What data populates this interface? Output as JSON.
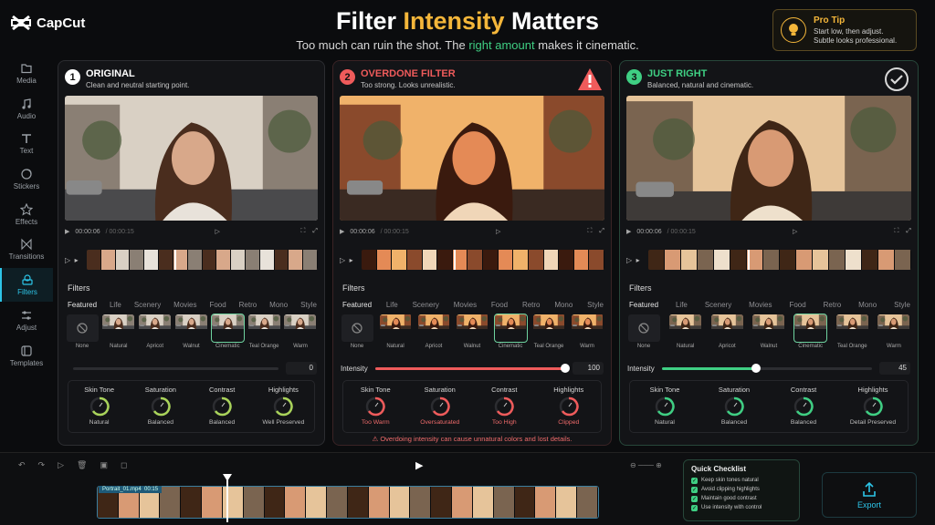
{
  "app": {
    "name": "CapCut"
  },
  "header": {
    "title_part1": "Filter ",
    "title_highlight": "Intensity",
    "title_part2": " Matters",
    "subtitle_part1": "Too much can ruin the shot. The ",
    "subtitle_highlight": "right amount",
    "subtitle_part2": " makes it cinematic."
  },
  "protip": {
    "title": "Pro Tip",
    "line1": "Start low, then adjust.",
    "line2": "Subtle looks professional."
  },
  "sidebar": {
    "items": [
      {
        "label": "Media",
        "icon": "folder-icon"
      },
      {
        "label": "Audio",
        "icon": "music-note-icon"
      },
      {
        "label": "Text",
        "icon": "text-icon"
      },
      {
        "label": "Stickers",
        "icon": "sticker-icon"
      },
      {
        "label": "Effects",
        "icon": "star-icon"
      },
      {
        "label": "Transitions",
        "icon": "transition-icon"
      },
      {
        "label": "Filters",
        "icon": "filters-icon"
      },
      {
        "label": "Adjust",
        "icon": "sliders-icon"
      },
      {
        "label": "Templates",
        "icon": "templates-icon"
      }
    ]
  },
  "panels": [
    {
      "num": "1",
      "title": "ORIGINAL",
      "desc": "Clean and neutral starting point.",
      "accent": "#ffffff",
      "time": "00:00:06",
      "duration": "/ 00:00:15",
      "filters_label": "Filters",
      "categories": [
        "Featured",
        "Life",
        "Scenery",
        "Movies",
        "Food",
        "Retro",
        "Mono",
        "Style"
      ],
      "thumbs": [
        "None",
        "Natural",
        "Apricot",
        "Walnut",
        "Cinematic",
        "Teal Orange",
        "Warm"
      ],
      "selected_thumb": 4,
      "intensity_label": "",
      "intensity_value": "0",
      "intensity": 0,
      "metrics": [
        {
          "name": "Skin Tone",
          "status": "Natural"
        },
        {
          "name": "Saturation",
          "status": "Balanced"
        },
        {
          "name": "Contrast",
          "status": "Balanced"
        },
        {
          "name": "Highlights",
          "status": "Well Preserved"
        }
      ],
      "warning": ""
    },
    {
      "num": "2",
      "title": "OVERDONE FILTER",
      "desc": "Too strong. Looks unrealistic.",
      "accent": "#ef5b5b",
      "time": "00:00:06",
      "duration": "/ 00:00:15",
      "filters_label": "Filters",
      "categories": [
        "Featured",
        "Life",
        "Scenery",
        "Movies",
        "Food",
        "Retro",
        "Mono",
        "Style"
      ],
      "thumbs": [
        "None",
        "Natural",
        "Apricot",
        "Walnut",
        "Cinematic",
        "Teal Orange",
        "Warm"
      ],
      "selected_thumb": 4,
      "intensity_label": "Intensity",
      "intensity_value": "100",
      "intensity": 100,
      "metrics": [
        {
          "name": "Skin Tone",
          "status": "Too Warm"
        },
        {
          "name": "Saturation",
          "status": "Oversaturated"
        },
        {
          "name": "Contrast",
          "status": "Too High"
        },
        {
          "name": "Highlights",
          "status": "Clipped"
        }
      ],
      "warning": "⚠ Overdoing intensity can cause unnatural colors and lost details."
    },
    {
      "num": "3",
      "title": "JUST RIGHT",
      "desc": "Balanced, natural and cinematic.",
      "accent": "#3fcf83",
      "time": "00:00:06",
      "duration": "/ 00:00:15",
      "filters_label": "Filters",
      "categories": [
        "Featured",
        "Life",
        "Scenery",
        "Movies",
        "Food",
        "Retro",
        "Mono",
        "Style"
      ],
      "thumbs": [
        "None",
        "Natural",
        "Apricot",
        "Walnut",
        "Cinematic",
        "Teal Orange",
        "Warm"
      ],
      "selected_thumb": 4,
      "intensity_label": "Intensity",
      "intensity_value": "45",
      "intensity": 45,
      "metrics": [
        {
          "name": "Skin Tone",
          "status": "Natural"
        },
        {
          "name": "Saturation",
          "status": "Balanced"
        },
        {
          "name": "Contrast",
          "status": "Balanced"
        },
        {
          "name": "Highlights",
          "status": "Detail Preserved"
        }
      ],
      "warning": ""
    }
  ],
  "timeline": {
    "clip_label": "Portrait_01.mp4",
    "clip_duration": "00:15"
  },
  "checklist": {
    "title": "Quick Checklist",
    "items": [
      "Keep skin tones natural",
      "Avoid clipping highlights",
      "Maintain good contrast",
      "Use intensity with control"
    ]
  },
  "export": {
    "label": "Export"
  },
  "colors": {
    "gold": "#f4b63a",
    "green": "#3fcf83",
    "red": "#ef5b5b",
    "cyan": "#2dc5e8"
  }
}
